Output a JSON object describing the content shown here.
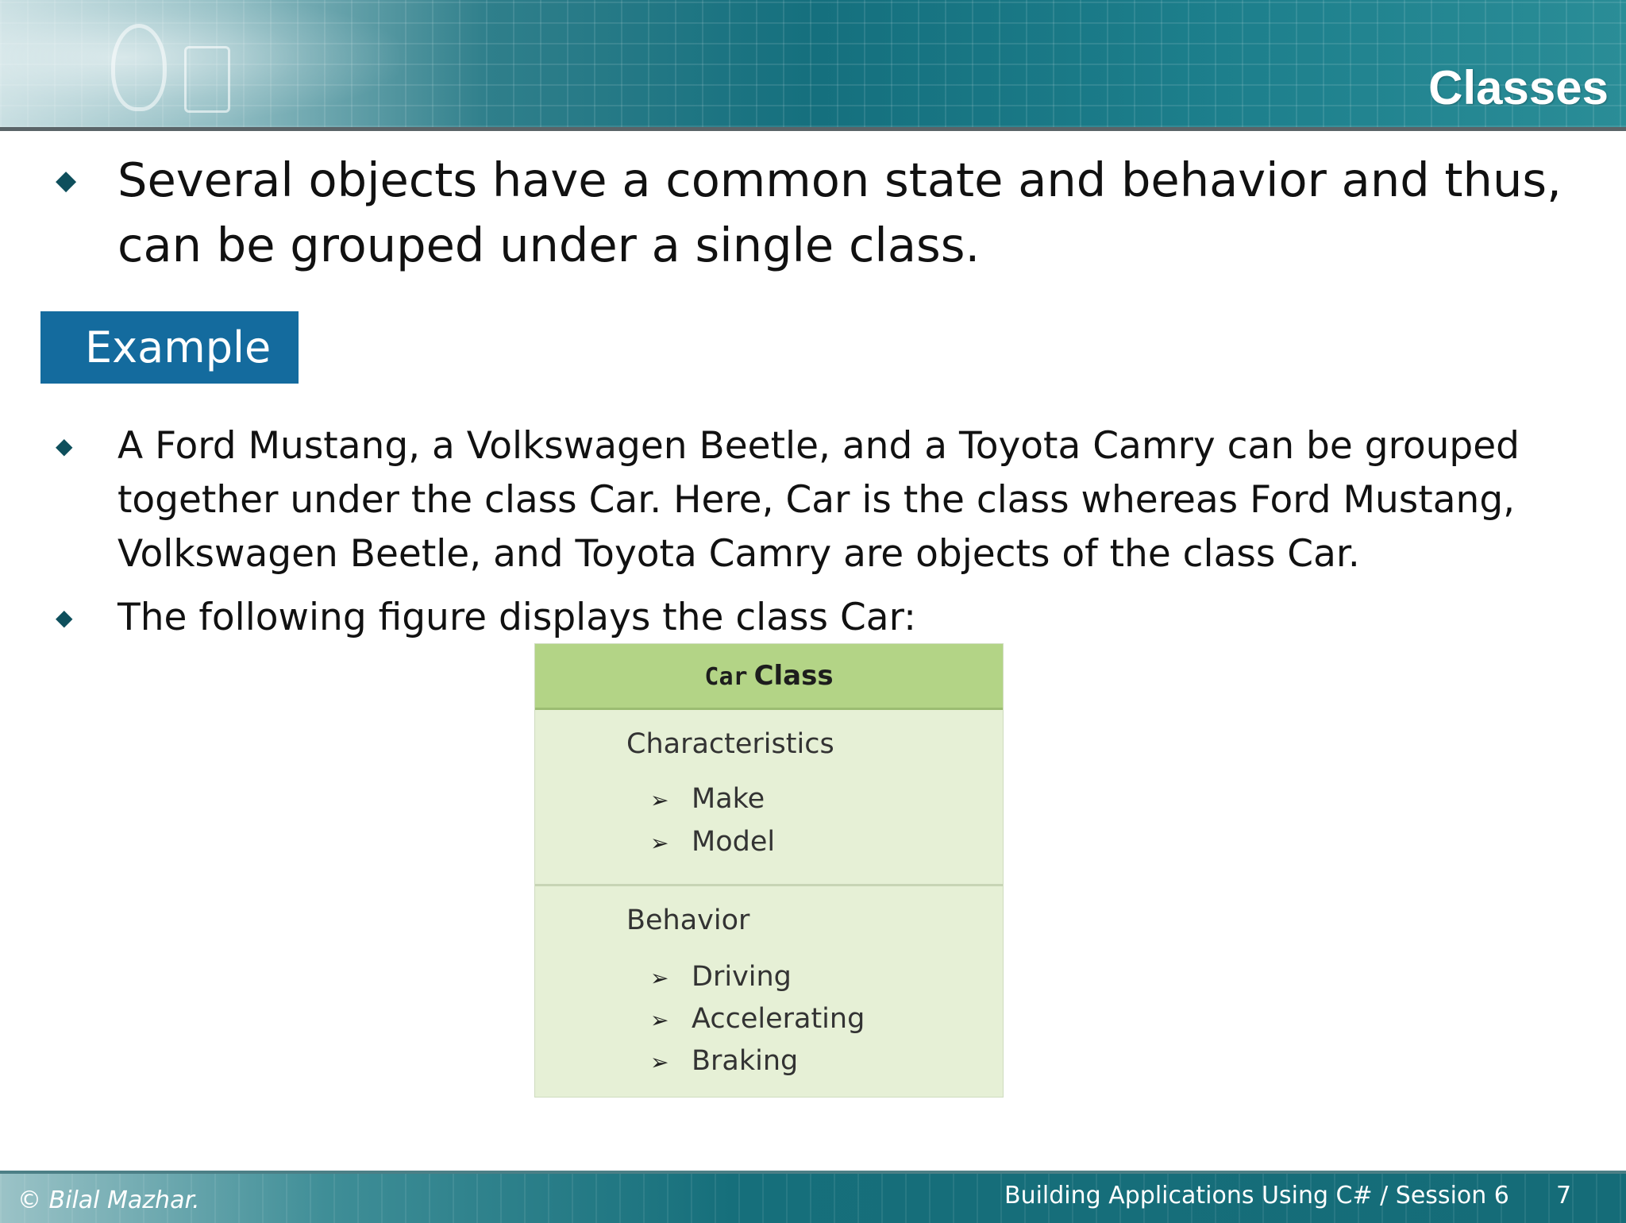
{
  "header": {
    "title": "Classes"
  },
  "bullets": [
    {
      "marker": "◆",
      "text": "Several objects have a common state and behavior and thus, can be grouped under a single class."
    },
    {
      "marker": "◆",
      "text": "A Ford Mustang, a Volkswagen Beetle, and a Toyota Camry can be grouped together under the class Car. Here, Car is the class whereas Ford Mustang, Volkswagen Beetle, and Toyota Camry are objects of the class Car."
    },
    {
      "marker": "◆",
      "text": "The following figure displays the class Car:"
    }
  ],
  "example_label": "Example",
  "figure": {
    "title_name": "Car",
    "title_suffix": "Class",
    "arrow": "➢",
    "characteristics": {
      "heading": "Characteristics",
      "items": [
        "Make",
        "Model"
      ]
    },
    "behavior": {
      "heading": "Behavior",
      "items": [
        "Driving",
        "Accelerating",
        "Braking"
      ]
    }
  },
  "footer": {
    "copyright": "© Bilal Mazhar.",
    "course": "Building Applications Using C# / Session 6",
    "page_number": "7"
  },
  "colors": {
    "header_teal": "#15707e",
    "example_box": "#146b9e",
    "figure_header": "#b3d486",
    "figure_body": "#e6f0d6",
    "bullet_marker": "#0e4f5c"
  }
}
